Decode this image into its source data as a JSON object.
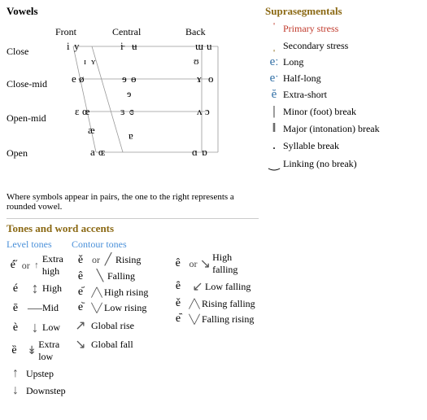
{
  "vowels": {
    "title": "Vowels",
    "col_front": "Front",
    "col_central": "Central",
    "col_back": "Back",
    "row_close": "Close",
    "row_close_mid": "Close-mid",
    "row_open_mid": "Open-mid",
    "row_open": "Open",
    "note": "Where symbols appear in pairs, the one to the right represents a rounded vowel."
  },
  "suprasegmentals": {
    "title": "Suprasegmentals",
    "items": [
      {
        "symbol": "ˈ",
        "label": "Primary stress",
        "color": "red"
      },
      {
        "symbol": "ˌ",
        "label": "Secondary stress",
        "color": "olive"
      },
      {
        "symbol": "eː",
        "label": "Long",
        "color": "blue"
      },
      {
        "symbol": "eˑ",
        "label": "Half-long",
        "color": "blue"
      },
      {
        "symbol": "ĕ",
        "label": "Extra-short",
        "color": "blue"
      },
      {
        "symbol": "|",
        "label": "Minor (foot) break",
        "color": "black"
      },
      {
        "symbol": "‖",
        "label": "Major (intonation) break",
        "color": "black"
      },
      {
        "symbol": ".",
        "label": "Syllable break",
        "color": "black"
      },
      {
        "symbol": "‿",
        "label": "Linking (no break)",
        "color": "black"
      }
    ]
  },
  "tones": {
    "title": "Tones and word accents",
    "level_subtitle": "Level tones",
    "contour_subtitle": "Contour tones",
    "level_rows": [
      {
        "sym": "é̋",
        "bar": "↑",
        "label": "Extra high"
      },
      {
        "sym": "é",
        "bar": "|",
        "label": "High"
      },
      {
        "sym": "ē",
        "bar": "–",
        "label": "Mid"
      },
      {
        "sym": "è",
        "bar": "↓",
        "label": "Low"
      },
      {
        "sym": "ȅ",
        "bar": "↓",
        "label": "Extra low"
      }
    ],
    "extra_rows": [
      {
        "sym": "↑",
        "label": "Upstep"
      },
      {
        "sym": "↓",
        "label": "Downstep"
      }
    ],
    "contour_mid_rows": [
      {
        "sym": "ě",
        "bar": "/",
        "label": "Rising"
      },
      {
        "sym": "ê",
        "bar": "\\",
        "label": "Falling"
      },
      {
        "sym": "e᷄",
        "bar": "/\\",
        "label": "High rising"
      },
      {
        "sym": "e᷅",
        "bar": "\\/",
        "label": "Low rising"
      }
    ],
    "contour_right_rows": [
      {
        "sym": "ê",
        "bar": "\\",
        "label": "High falling"
      },
      {
        "sym": "ȇ",
        "bar": "↘",
        "label": "Low falling"
      },
      {
        "sym": "ě",
        "bar": "/\\",
        "label": "Rising falling"
      },
      {
        "sym": "e᷈",
        "bar": "\\/",
        "label": "Falling rising"
      }
    ],
    "global_rows": [
      {
        "sym": "↗",
        "label": "Global rise"
      },
      {
        "sym": "↘",
        "label": "Global fall"
      }
    ]
  }
}
